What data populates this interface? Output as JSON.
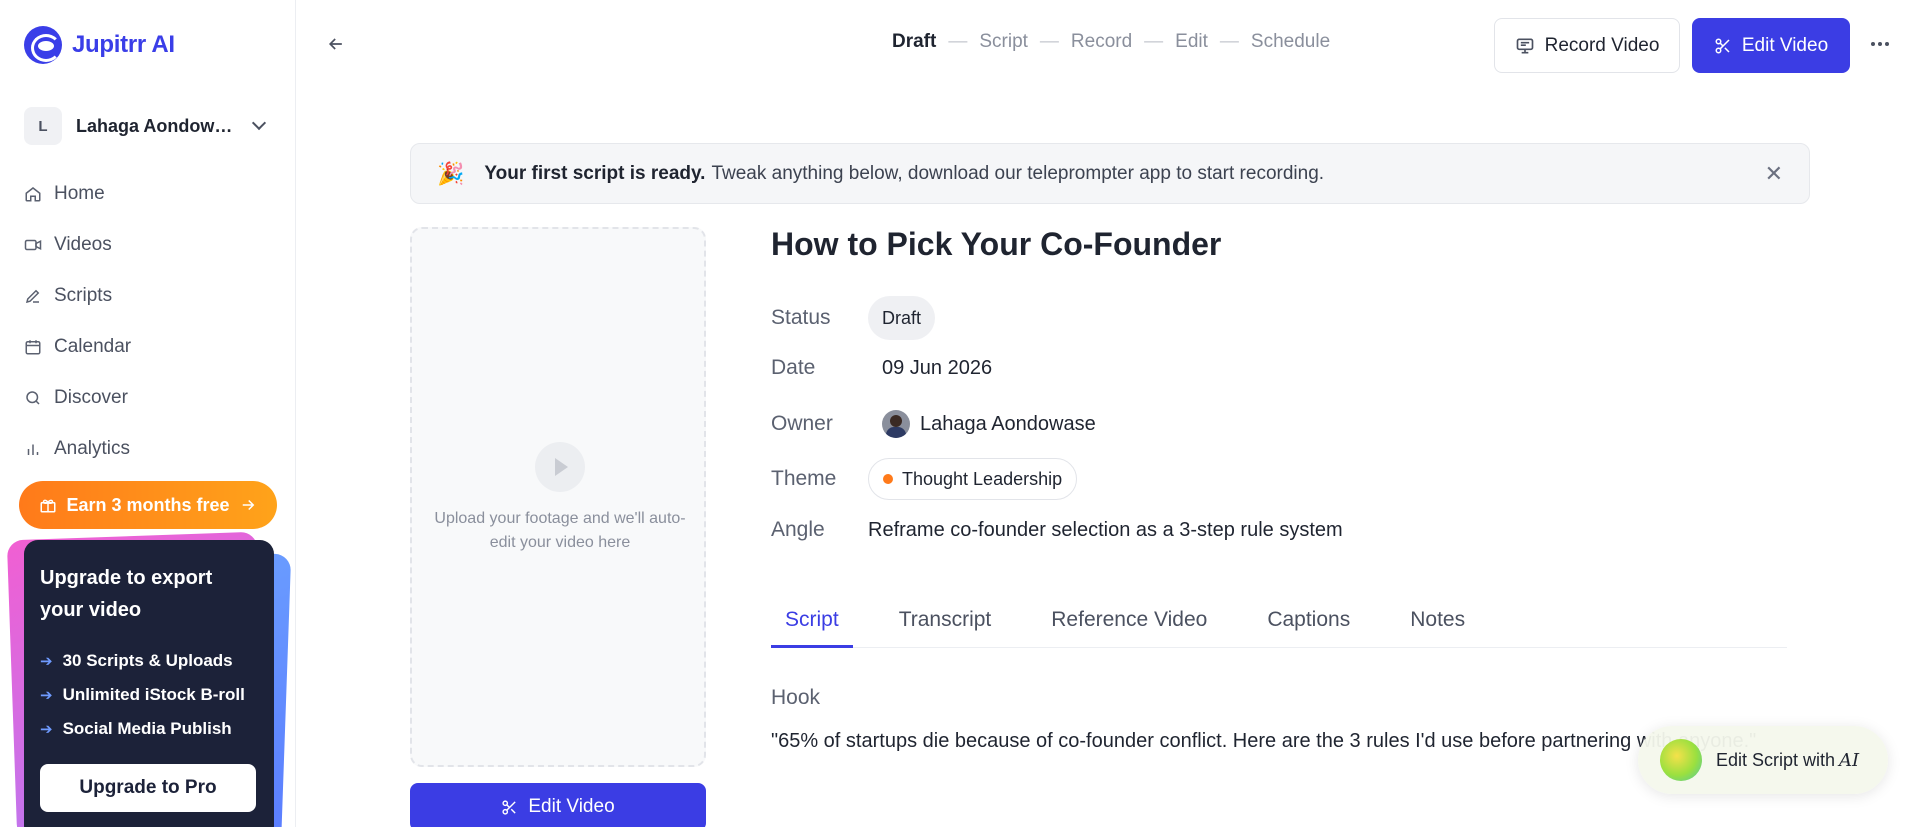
{
  "app": {
    "name": "Jupitrr AI"
  },
  "workspace": {
    "initial": "L",
    "name": "Lahaga Aondowase"
  },
  "nav": [
    {
      "label": "Home",
      "icon": "home-icon"
    },
    {
      "label": "Videos",
      "icon": "video-icon"
    },
    {
      "label": "Scripts",
      "icon": "pencil-icon"
    },
    {
      "label": "Calendar",
      "icon": "calendar-icon"
    },
    {
      "label": "Discover",
      "icon": "search-icon"
    },
    {
      "label": "Analytics",
      "icon": "bar-chart-icon"
    }
  ],
  "promo": {
    "earn_label": "Earn 3 months free"
  },
  "upgrade": {
    "title": "Upgrade to export your video",
    "features": [
      "30 Scripts & Uploads",
      "Unlimited iStock B-roll",
      "Social Media Publish"
    ],
    "button": "Upgrade to Pro"
  },
  "steps": [
    "Draft",
    "Script",
    "Record",
    "Edit",
    "Schedule"
  ],
  "topbar": {
    "record_label": "Record Video",
    "edit_label": "Edit Video"
  },
  "banner": {
    "bold": "Your first script is ready.",
    "text": "Tweak anything below, download our teleprompter app to start recording.",
    "emoji": "🎉"
  },
  "upload": {
    "text": "Upload your footage and we'll auto-edit your video here",
    "button": "Edit Video"
  },
  "video": {
    "title": "How to Pick Your Co-Founder",
    "labels": {
      "status": "Status",
      "date": "Date",
      "owner": "Owner",
      "theme": "Theme",
      "angle": "Angle"
    },
    "status": "Draft",
    "date": "09 Jun 2026",
    "owner": "Lahaga Aondowase",
    "theme": "Thought Leadership",
    "theme_color": "#ff7a1a",
    "angle": "Reframe co-founder selection as a 3-step rule system"
  },
  "tabs": [
    "Script",
    "Transcript",
    "Reference Video",
    "Captions",
    "Notes"
  ],
  "script": {
    "hook_label": "Hook",
    "hook_text": "\"65% of startups die because of co-founder conflict. Here are the 3 rules I'd use before partnering with anyone.\""
  },
  "ai_button": {
    "label": "Edit Script with",
    "suffix": "AI"
  },
  "colors": {
    "primary": "#3b3de4",
    "accent": "#ff7a1a",
    "card": "#1c2239"
  }
}
